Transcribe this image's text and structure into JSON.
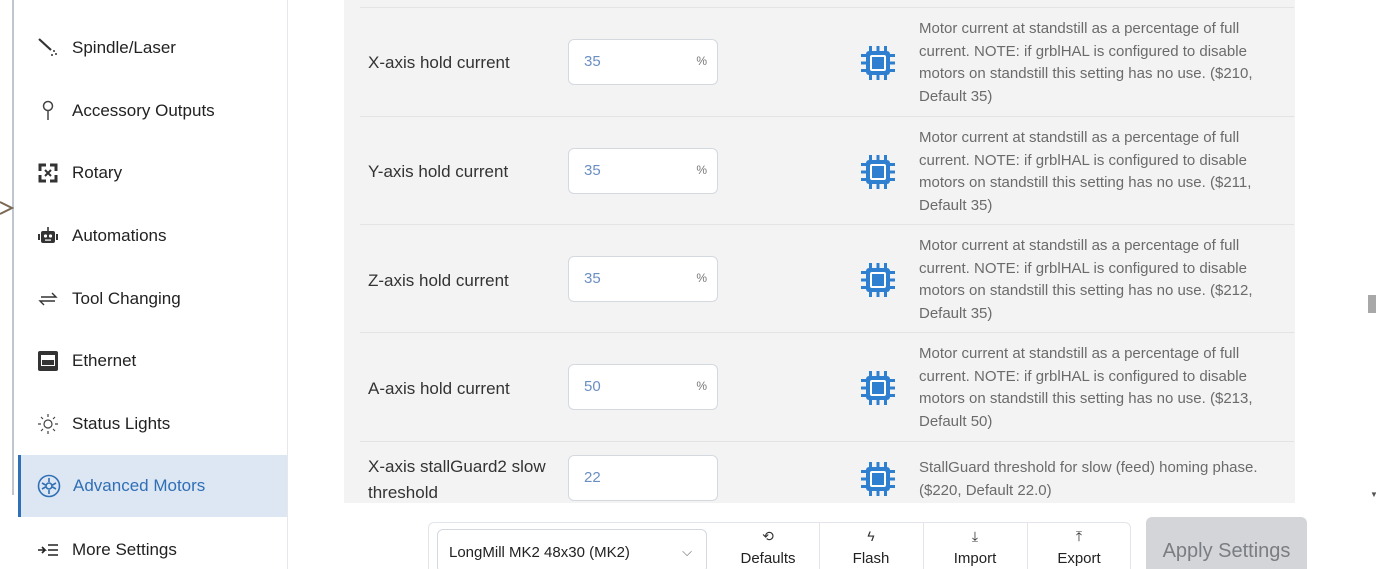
{
  "sidebar": {
    "items": [
      {
        "label": "Spindle/Laser",
        "icon": "spindle-laser-icon"
      },
      {
        "label": "Accessory Outputs",
        "icon": "accessory-outputs-icon"
      },
      {
        "label": "Rotary",
        "icon": "rotary-icon"
      },
      {
        "label": "Automations",
        "icon": "robot-icon"
      },
      {
        "label": "Tool Changing",
        "icon": "swap-arrows-icon"
      },
      {
        "label": "Ethernet",
        "icon": "ethernet-icon"
      },
      {
        "label": "Status Lights",
        "icon": "sun-icon"
      },
      {
        "label": "Advanced Motors",
        "icon": "motor-icon",
        "active": true
      },
      {
        "label": "More Settings",
        "icon": "more-settings-icon"
      }
    ]
  },
  "settings": [
    {
      "label": "X-axis hold current",
      "value": "35",
      "unit": "%",
      "desc": [
        "Motor current at standstill as a percentage of full",
        "current. NOTE: if grblHAL is configured to disable",
        "motors on standstill this setting has no use. ($210,",
        "Default 35)"
      ]
    },
    {
      "label": "Y-axis hold current",
      "value": "35",
      "unit": "%",
      "desc": [
        "Motor current at standstill as a percentage of full",
        "current. NOTE: if grblHAL is configured to disable",
        "motors on standstill this setting has no use. ($211,",
        "Default 35)"
      ]
    },
    {
      "label": "Z-axis hold current",
      "value": "35",
      "unit": "%",
      "desc": [
        "Motor current at standstill as a percentage of full",
        "current. NOTE: if grblHAL is configured to disable",
        "motors on standstill this setting has no use. ($212,",
        "Default 35)"
      ]
    },
    {
      "label": "A-axis hold current",
      "value": "50",
      "unit": "%",
      "desc": [
        "Motor current at standstill as a percentage of full",
        "current. NOTE: if grblHAL is configured to disable",
        "motors on standstill this setting has no use. ($213,",
        "Default 50)"
      ]
    },
    {
      "label_lines": [
        "X-axis stallGuard2 slow",
        "threshold"
      ],
      "value": "22",
      "desc": [
        "StallGuard threshold for slow (feed) homing phase.",
        "($220, Default 22.0)"
      ]
    }
  ],
  "toolbar": {
    "profile": "LongMill MK2 48x30 (MK2)",
    "defaults_label": "Defaults",
    "flash_label": "Flash",
    "import_label": "Import",
    "export_label": "Export",
    "apply_label": "Apply Settings"
  },
  "colors": {
    "accent": "#2f6fb5",
    "chip": "#2f7fd0",
    "active_bg": "#dde7f3",
    "panel_bg": "#f3f3f3"
  }
}
